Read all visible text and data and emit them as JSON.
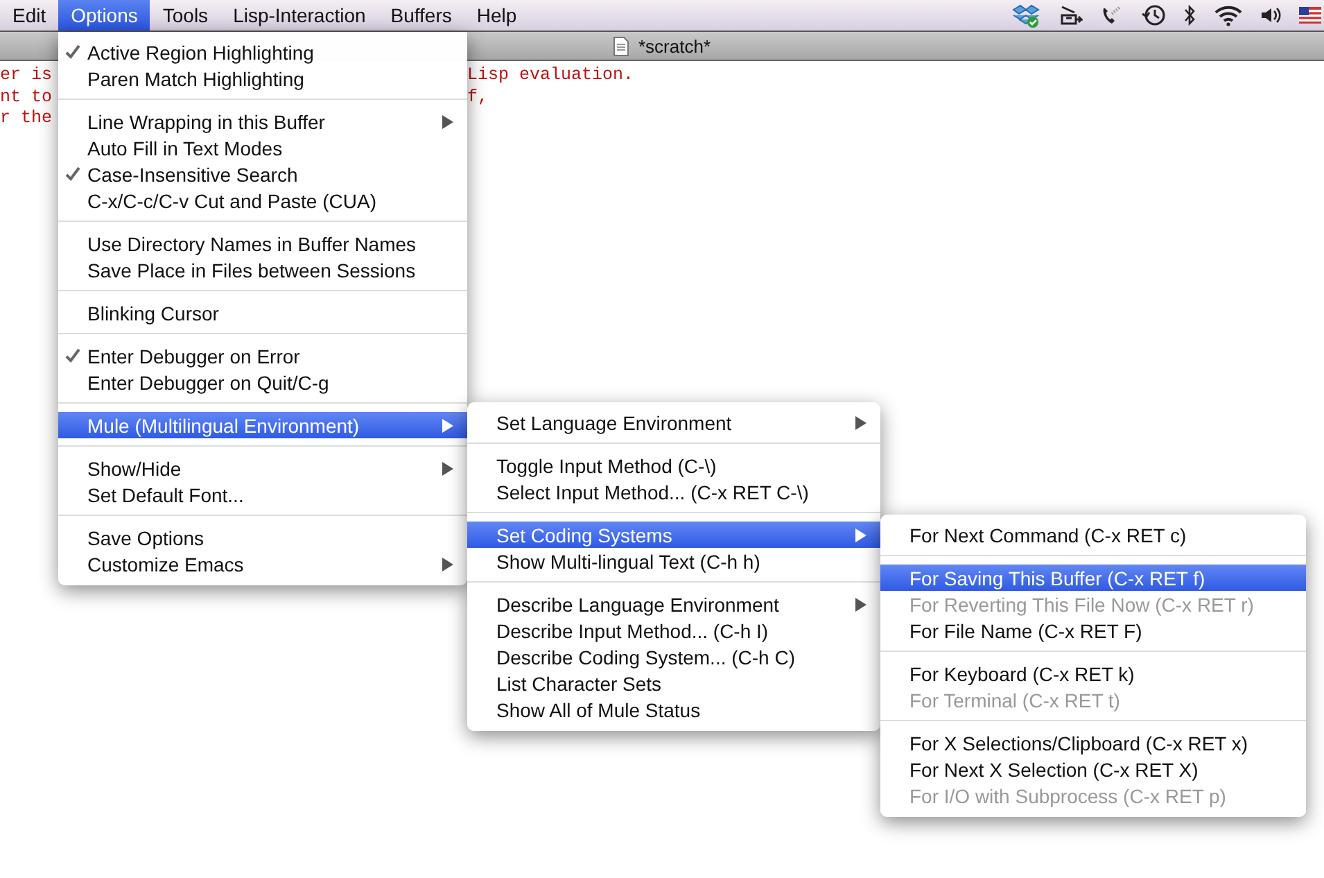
{
  "menubar": {
    "items": [
      {
        "label": "Edit",
        "selected": false
      },
      {
        "label": "Options",
        "selected": true
      },
      {
        "label": "Tools",
        "selected": false
      },
      {
        "label": "Lisp-Interaction",
        "selected": false
      },
      {
        "label": "Buffers",
        "selected": false
      },
      {
        "label": "Help",
        "selected": false
      }
    ]
  },
  "window": {
    "title": "*scratch*"
  },
  "editor": {
    "lines": [
      {
        "left": "er is",
        "right": "Lisp evaluation."
      },
      {
        "left": "nt to",
        "right": "f,"
      },
      {
        "left": "r the"
      }
    ]
  },
  "menus": [
    {
      "groups": [
        [
          {
            "label": "Active Region Highlighting",
            "checked": true,
            "submenu": false,
            "disabled": false,
            "selected": false
          },
          {
            "label": "Paren Match Highlighting",
            "checked": false,
            "submenu": false,
            "disabled": false,
            "selected": false
          }
        ],
        [
          {
            "label": "Line Wrapping in this Buffer",
            "checked": false,
            "submenu": true,
            "disabled": false,
            "selected": false
          },
          {
            "label": "Auto Fill in Text Modes",
            "checked": false,
            "submenu": false,
            "disabled": false,
            "selected": false
          },
          {
            "label": "Case-Insensitive Search",
            "checked": true,
            "submenu": false,
            "disabled": false,
            "selected": false
          },
          {
            "label": "C-x/C-c/C-v Cut and Paste (CUA)",
            "checked": false,
            "submenu": false,
            "disabled": false,
            "selected": false
          }
        ],
        [
          {
            "label": "Use Directory Names in Buffer Names",
            "checked": false,
            "submenu": false,
            "disabled": false,
            "selected": false
          },
          {
            "label": "Save Place in Files between Sessions",
            "checked": false,
            "submenu": false,
            "disabled": false,
            "selected": false
          }
        ],
        [
          {
            "label": "Blinking Cursor",
            "checked": false,
            "submenu": false,
            "disabled": false,
            "selected": false
          }
        ],
        [
          {
            "label": "Enter Debugger on Error",
            "checked": true,
            "submenu": false,
            "disabled": false,
            "selected": false
          },
          {
            "label": "Enter Debugger on Quit/C-g",
            "checked": false,
            "submenu": false,
            "disabled": false,
            "selected": false
          }
        ],
        [
          {
            "label": "Mule (Multilingual Environment)",
            "checked": false,
            "submenu": true,
            "disabled": false,
            "selected": true
          }
        ],
        [
          {
            "label": "Show/Hide",
            "checked": false,
            "submenu": true,
            "disabled": false,
            "selected": false
          },
          {
            "label": "Set Default Font...",
            "checked": false,
            "submenu": false,
            "disabled": false,
            "selected": false
          }
        ],
        [
          {
            "label": "Save Options",
            "checked": false,
            "submenu": false,
            "disabled": false,
            "selected": false
          },
          {
            "label": "Customize Emacs",
            "checked": false,
            "submenu": true,
            "disabled": false,
            "selected": false
          }
        ]
      ]
    },
    {
      "groups": [
        [
          {
            "label": "Set Language Environment",
            "checked": false,
            "submenu": true,
            "disabled": false,
            "selected": false
          }
        ],
        [
          {
            "label": "Toggle Input Method (C-\\)",
            "checked": false,
            "submenu": false,
            "disabled": false,
            "selected": false
          },
          {
            "label": "Select Input Method... (C-x RET C-\\)",
            "checked": false,
            "submenu": false,
            "disabled": false,
            "selected": false
          }
        ],
        [
          {
            "label": "Set Coding Systems",
            "checked": false,
            "submenu": true,
            "disabled": false,
            "selected": true
          },
          {
            "label": "Show Multi-lingual Text (C-h h)",
            "checked": false,
            "submenu": false,
            "disabled": false,
            "selected": false
          }
        ],
        [
          {
            "label": "Describe Language Environment",
            "checked": false,
            "submenu": true,
            "disabled": false,
            "selected": false
          },
          {
            "label": "Describe Input Method... (C-h I)",
            "checked": false,
            "submenu": false,
            "disabled": false,
            "selected": false
          },
          {
            "label": "Describe Coding System... (C-h C)",
            "checked": false,
            "submenu": false,
            "disabled": false,
            "selected": false
          },
          {
            "label": "List Character Sets",
            "checked": false,
            "submenu": false,
            "disabled": false,
            "selected": false
          },
          {
            "label": "Show All of Mule Status",
            "checked": false,
            "submenu": false,
            "disabled": false,
            "selected": false
          }
        ]
      ]
    },
    {
      "groups": [
        [
          {
            "label": "For Next Command (C-x RET c)",
            "checked": false,
            "submenu": false,
            "disabled": false,
            "selected": false
          }
        ],
        [
          {
            "label": "For Saving This Buffer (C-x RET f)",
            "checked": false,
            "submenu": false,
            "disabled": false,
            "selected": true
          },
          {
            "label": "For Reverting This File Now (C-x RET r)",
            "checked": false,
            "submenu": false,
            "disabled": true,
            "selected": false
          },
          {
            "label": "For File Name (C-x RET F)",
            "checked": false,
            "submenu": false,
            "disabled": false,
            "selected": false
          }
        ],
        [
          {
            "label": "For Keyboard (C-x RET k)",
            "checked": false,
            "submenu": false,
            "disabled": false,
            "selected": false
          },
          {
            "label": "For Terminal (C-x RET t)",
            "checked": false,
            "submenu": false,
            "disabled": true,
            "selected": false
          }
        ],
        [
          {
            "label": "For X Selections/Clipboard (C-x RET x)",
            "checked": false,
            "submenu": false,
            "disabled": false,
            "selected": false
          },
          {
            "label": "For Next X Selection (C-x RET X)",
            "checked": false,
            "submenu": false,
            "disabled": false,
            "selected": false
          },
          {
            "label": "For I/O with Subprocess (C-x RET p)",
            "checked": false,
            "submenu": false,
            "disabled": true,
            "selected": false
          }
        ]
      ]
    }
  ]
}
